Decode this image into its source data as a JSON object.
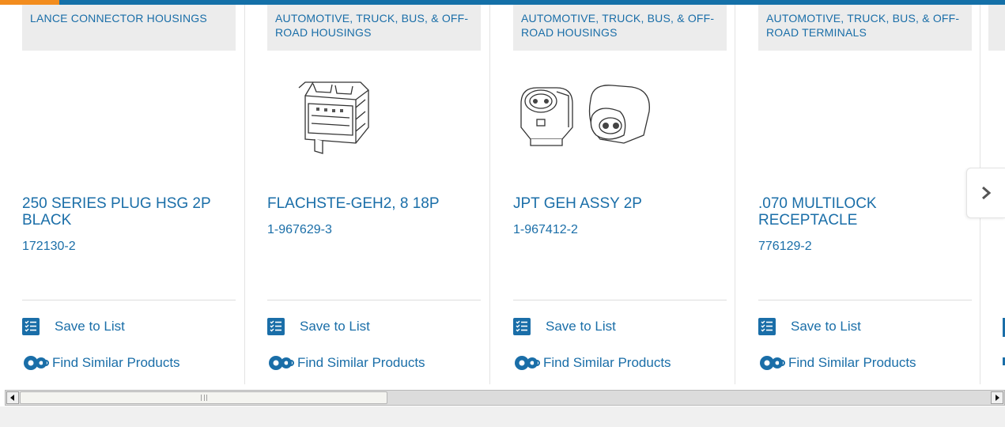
{
  "colors": {
    "accent_blue": "#1a6ea8",
    "top_bar": "#1470a8",
    "top_bar_accent": "#f28c1e",
    "category_bg": "#ececec"
  },
  "products": [
    {
      "category": "LANCE CONNECTOR HOUSINGS",
      "title": "250 SERIES PLUG HSG 2P BLACK",
      "part_number": "172130-2",
      "has_image": false
    },
    {
      "category": "AUTOMOTIVE, TRUCK, BUS, & OFF-ROAD HOUSINGS",
      "title": "FLACHSTE-GEH2, 8 18P",
      "part_number": "1-967629-3",
      "has_image": true
    },
    {
      "category": "AUTOMOTIVE, TRUCK, BUS, & OFF-ROAD HOUSINGS",
      "title": "JPT GEH ASSY 2P",
      "part_number": "1-967412-2",
      "has_image": true
    },
    {
      "category": "AUTOMOTIVE, TRUCK, BUS, & OFF-ROAD TERMINALS",
      "title": ".070 MULTILOCK RECEPTACLE",
      "part_number": "776129-2",
      "has_image": false
    }
  ],
  "actions": {
    "save_label": "Save to List",
    "find_label": "Find Similar Products"
  },
  "icons": {
    "save": "checklist-icon",
    "find": "gears-icon",
    "next": "chevron-right-icon"
  }
}
